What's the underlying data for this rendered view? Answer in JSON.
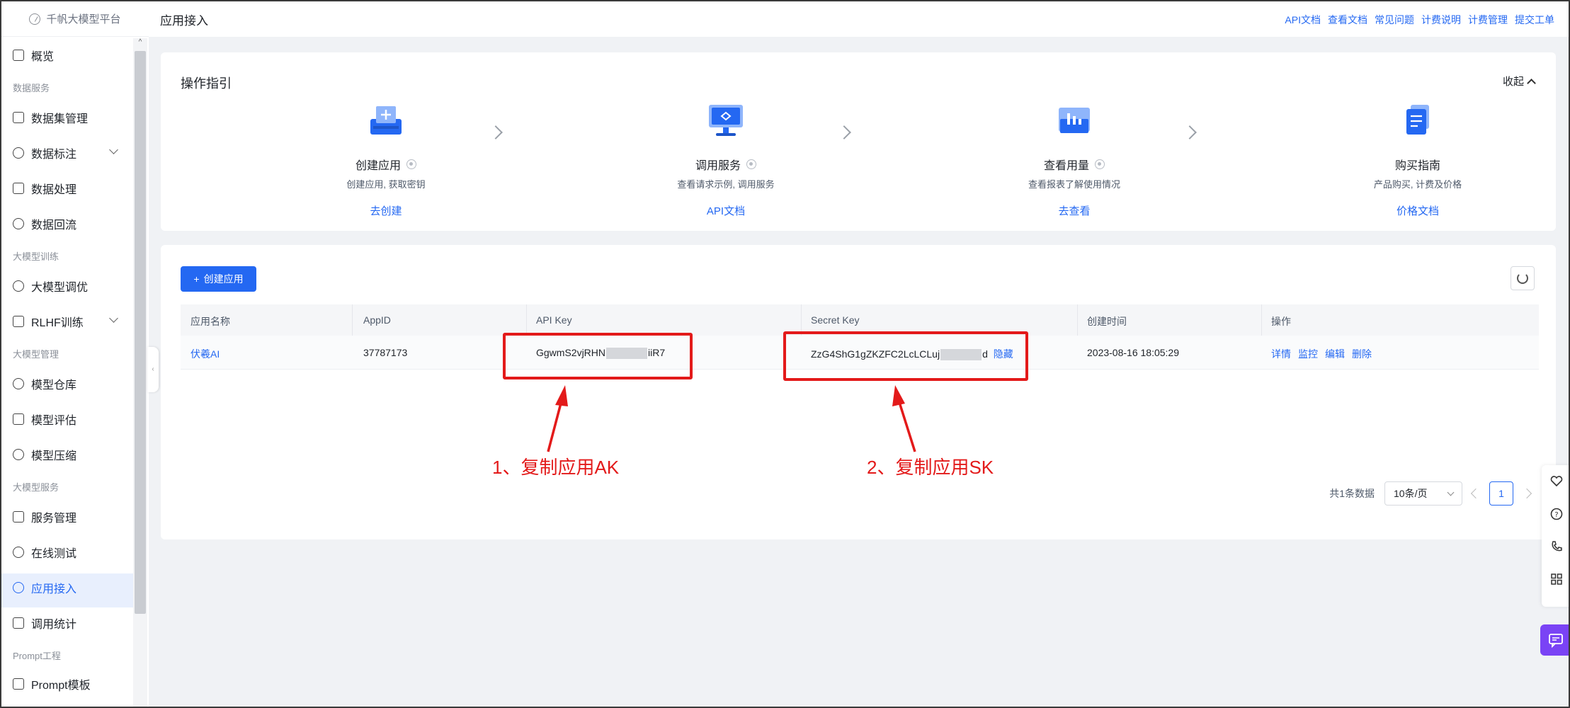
{
  "platform": {
    "logo_text": "千帆大模型平台"
  },
  "sidebar": {
    "items": [
      {
        "label": "概览"
      },
      {
        "group": "数据服务"
      },
      {
        "label": "数据集管理"
      },
      {
        "label": "数据标注"
      },
      {
        "label": "数据处理"
      },
      {
        "label": "数据回流"
      },
      {
        "group": "大模型训练"
      },
      {
        "label": "大模型调优"
      },
      {
        "label": "RLHF训练"
      },
      {
        "group": "大模型管理"
      },
      {
        "label": "模型仓库"
      },
      {
        "label": "模型评估"
      },
      {
        "label": "模型压缩"
      },
      {
        "group": "大模型服务"
      },
      {
        "label": "服务管理"
      },
      {
        "label": "在线测试"
      },
      {
        "label": "应用接入"
      },
      {
        "label": "调用统计"
      },
      {
        "group": "Prompt工程"
      },
      {
        "label": "Prompt模板"
      }
    ],
    "active": "应用接入"
  },
  "header": {
    "title": "应用接入",
    "links": [
      "API文档",
      "查看文档",
      "常见问题",
      "计费说明",
      "计费管理",
      "提交工单"
    ]
  },
  "guide": {
    "title": "操作指引",
    "collapse_label": "收起",
    "steps": [
      {
        "name": "创建应用",
        "desc": "创建应用, 获取密钥",
        "link": "去创建",
        "icon": "create-app-icon"
      },
      {
        "name": "调用服务",
        "desc": "查看请求示例, 调用服务",
        "link": "API文档",
        "icon": "call-service-icon"
      },
      {
        "name": "查看用量",
        "desc": "查看报表了解使用情况",
        "link": "去查看",
        "icon": "usage-chart-icon"
      },
      {
        "name": "购买指南",
        "desc": "产品购买, 计费及价格",
        "link": "价格文档",
        "icon": "purchase-guide-icon"
      }
    ]
  },
  "apps": {
    "create_button": "创建应用",
    "columns": [
      "应用名称",
      "AppID",
      "API Key",
      "Secret Key",
      "创建时间",
      "操作"
    ],
    "rows": [
      {
        "name": "伏羲AI",
        "app_id": "37787173",
        "api_key_prefix": "GgwmS2vjRHN",
        "api_key_suffix": "iiR7",
        "secret_key_prefix": "ZzG4ShG1gZKZFC2LcLCLuj",
        "secret_key_suffix": "d",
        "hide_label": "隐藏",
        "created": "2023-08-16 18:05:29",
        "ops": [
          "详情",
          "监控",
          "编辑",
          "删除"
        ]
      }
    ],
    "total_text": "共1条数据",
    "page_size": "10条/页",
    "current_page": "1"
  },
  "annotations": {
    "ak": "1、复制应用AK",
    "sk": "2、复制应用SK",
    "color": "#e31a1a"
  },
  "colors": {
    "primary": "#2468f2",
    "chat": "#7a43f5"
  }
}
